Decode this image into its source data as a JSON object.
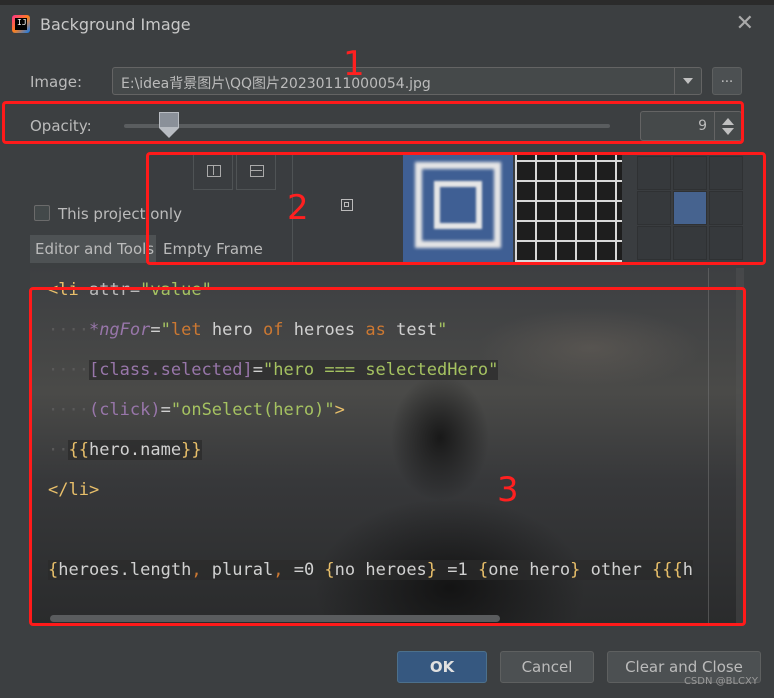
{
  "window": {
    "title": "Background Image",
    "close_glyph": "✕",
    "app_icon_text": "IJ"
  },
  "image_field": {
    "label": "Image:",
    "value": "E:\\idea背景图片\\QQ图片20230111000054.jpg",
    "browse_label": "..."
  },
  "opacity": {
    "label": "Opacity:",
    "value": "9",
    "slider_fraction": 0.09
  },
  "checkbox": {
    "label": "This project only",
    "checked": false
  },
  "tabs": [
    {
      "label": "Editor and Tools",
      "active": true
    },
    {
      "label": "Empty Frame",
      "active": false
    }
  ],
  "editor_code": {
    "line1": {
      "lt": "<",
      "tag": "li",
      "attr": " attr=",
      "str": "\"value\""
    },
    "line2": {
      "indent": "····",
      "dir": "*ngFor",
      "eq": "=",
      "q1": "\"",
      "kw1": "let",
      "t1": " hero ",
      "kw2": "of",
      "t2": " heroes ",
      "kw3": "as",
      "t3": " test",
      "q2": "\""
    },
    "line3": {
      "indent": "····",
      "prop": "[class.selected]",
      "eq": "=",
      "str": "\"hero === selectedHero\""
    },
    "line4": {
      "indent": "····",
      "prop": "(click)",
      "eq": "=",
      "str": "\"onSelect(hero)\"",
      "gt": ">"
    },
    "line5": {
      "indent": "··",
      "open": "{{",
      "text": "hero.name",
      "close": "}}"
    },
    "line6": {
      "text": "</li>"
    },
    "line7": {
      "b1": "{",
      "t1": "heroes.length",
      "c1": ",",
      "t2": " plural",
      "c2": ",",
      "t3": " =0 ",
      "b2": "{",
      "t4": "no heroes",
      "b3": "}",
      "t5": " =1 ",
      "b4": "{",
      "t6": "one hero",
      "b5": "}",
      "t7": " other ",
      "b6": "{{{",
      "t8": "h"
    }
  },
  "annotations": {
    "n1": "1",
    "n2": "2",
    "n3": "3"
  },
  "buttons": {
    "ok": "OK",
    "cancel": "Cancel",
    "clear": "Clear and Close"
  },
  "watermark": "CSDN @BLCXY",
  "colors": {
    "annotation": "#ff1a1a",
    "ok_button": "#365880",
    "dialog_bg": "#3c3f41"
  },
  "icons": [
    "app-logo-icon",
    "close-icon",
    "dropdown-arrow-icon",
    "split-vertical-icon",
    "split-horizontal-icon",
    "spinner-up-icon",
    "spinner-down-icon"
  ]
}
